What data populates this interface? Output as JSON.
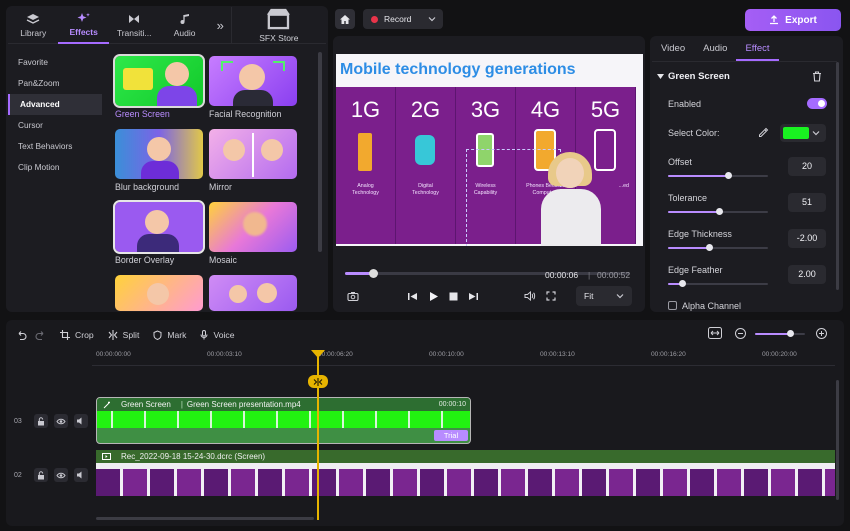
{
  "left_tabs": [
    {
      "label": "Library",
      "icon": "layers-icon"
    },
    {
      "label": "Effects",
      "icon": "sparkle-icon",
      "active": true
    },
    {
      "label": "Transiti...",
      "icon": "bowtie-icon"
    },
    {
      "label": "Audio",
      "icon": "music-note-icon"
    }
  ],
  "more_tabs_glyph": "»",
  "sfx_store": "SFX Store",
  "categories": [
    "Favorite",
    "Pan&Zoom",
    "Advanced",
    "Cursor",
    "Text Behaviors",
    "Clip Motion"
  ],
  "active_category": "Advanced",
  "effects": [
    "Green Screen",
    "Facial Recognition",
    "Blur background",
    "Mirror",
    "Border Overlay",
    "Mosaic"
  ],
  "selected_effect": "Green Screen",
  "header": {
    "record_label": "Record",
    "export_label": "Export"
  },
  "preview": {
    "slide_title": "Mobile technology generations",
    "generations": [
      {
        "gen": "1G",
        "caption": "Analog\nTechnology"
      },
      {
        "gen": "2G",
        "caption": "Digital\nTechnology"
      },
      {
        "gen": "3G",
        "caption": "Wireless\nCapability"
      },
      {
        "gen": "4G",
        "caption": "Phones Became\nComputers"
      },
      {
        "gen": "5G",
        "caption": "...ed"
      }
    ],
    "current_time": "00:00:06",
    "time_separator": "|",
    "total_time": "00:00:52",
    "progress": 0.1,
    "fit_option": "Fit"
  },
  "props": {
    "tabs": [
      "Video",
      "Audio",
      "Effect"
    ],
    "active_tab": "Effect",
    "section_title": "Green Screen",
    "enabled_label": "Enabled",
    "enabled": true,
    "select_color_label": "Select Color:",
    "selected_color": "#19f221",
    "offset_label": "Offset",
    "offset_value": "20",
    "tolerance_label": "Tolerance",
    "tolerance_value": "51",
    "edge_thickness_label": "Edge Thickness",
    "edge_thickness_value": "-2.00",
    "edge_feather_label": "Edge Feather",
    "edge_feather_value": "2.00",
    "alpha_label": "Alpha Channel"
  },
  "timeline": {
    "tools": [
      "Crop",
      "Split",
      "Mark",
      "Voice"
    ],
    "ruler": [
      "00:00:00:00",
      "00:00:03:10",
      "00:00:06:20",
      "00:00:10:00",
      "00:00:13:10",
      "00:00:16:20",
      "00:00:20:00"
    ],
    "tracks": [
      {
        "num": "03",
        "clip_effect": "Green Screen",
        "clip_name": "Green Screen presentation.mp4",
        "clip_time": "00:00:10",
        "badge": "Trial"
      },
      {
        "num": "02",
        "clip_name": "Rec_2022-09-18 15-24-30.dcrc (Screen)"
      }
    ]
  },
  "accent_color": "#a56bff",
  "playhead_color": "#e7b400"
}
